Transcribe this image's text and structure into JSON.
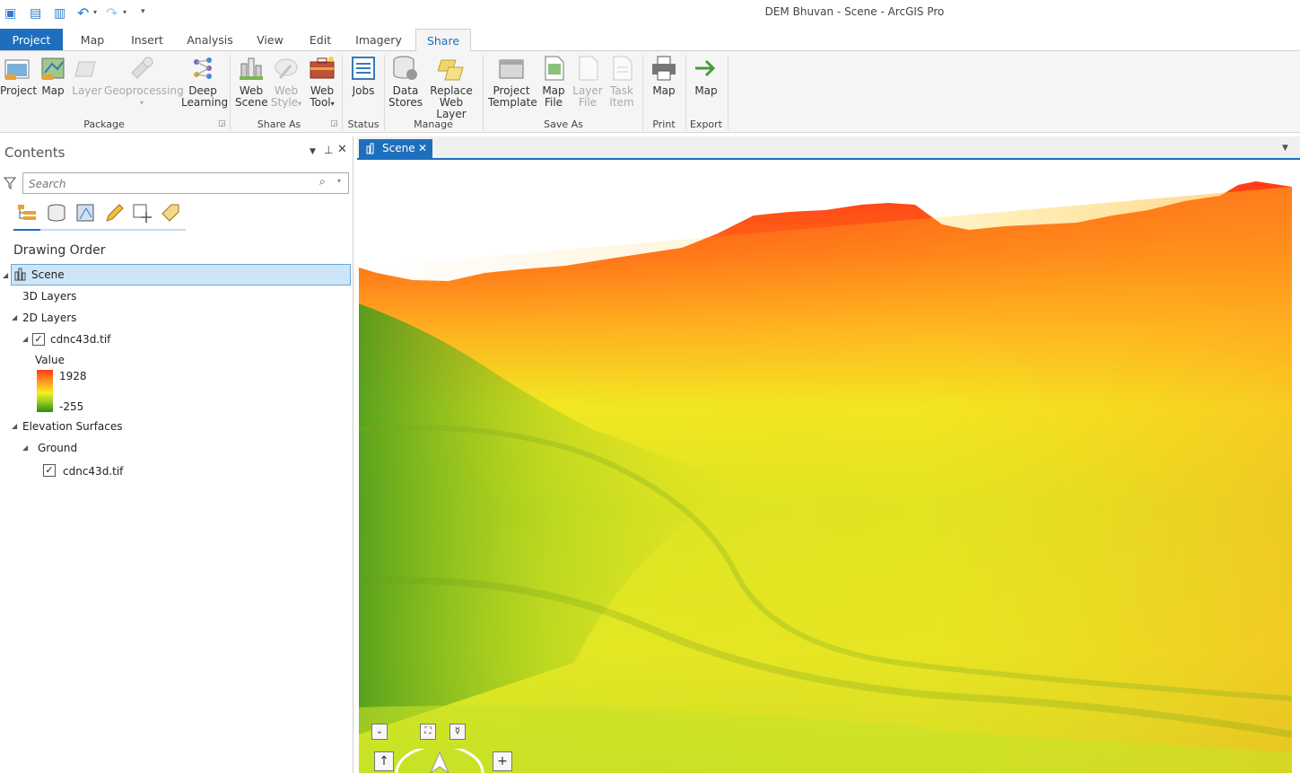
{
  "window": {
    "title": "DEM Bhuvan - Scene - ArcGIS Pro"
  },
  "tabs": [
    "Project",
    "Map",
    "Insert",
    "Analysis",
    "View",
    "Edit",
    "Imagery",
    "Share"
  ],
  "ribbon": {
    "package": {
      "group": "Package",
      "items": [
        [
          "Project"
        ],
        [
          "Map"
        ],
        [
          "Layer"
        ],
        [
          "Geoprocessing"
        ],
        [
          "Deep",
          "Learning"
        ]
      ]
    },
    "share_as": {
      "group": "Share As",
      "items": [
        [
          "Web",
          "Scene"
        ],
        [
          "Web",
          "Style"
        ],
        [
          "Web",
          "Tool"
        ]
      ]
    },
    "status": {
      "group": "Status",
      "items": [
        [
          "Jobs"
        ]
      ]
    },
    "manage": {
      "group": "Manage",
      "items": [
        [
          "Data",
          "Stores"
        ],
        [
          "Replace",
          "Web Layer"
        ]
      ]
    },
    "save_as": {
      "group": "Save As",
      "items": [
        [
          "Project",
          "Template"
        ],
        [
          "Map",
          "File"
        ],
        [
          "Layer",
          "File"
        ],
        [
          "Task",
          "Item"
        ]
      ]
    },
    "print": {
      "group": "Print",
      "items": [
        [
          "Map"
        ]
      ]
    },
    "export": {
      "group": "Export",
      "items": [
        [
          "Map"
        ]
      ]
    }
  },
  "contents": {
    "title": "Contents",
    "search_placeholder": "Search",
    "section": "Drawing Order",
    "scene": "Scene",
    "layers_3d": "3D Layers",
    "layers_2d": "2D Layers",
    "layer_name": "cdnc43d.tif",
    "legend_title": "Value",
    "legend_max": "1928",
    "legend_min": "-255",
    "elevation": "Elevation Surfaces",
    "ground": "Ground",
    "ground_layer": "cdnc43d.tif"
  },
  "view": {
    "tab_label": "Scene"
  },
  "colors": {
    "accent": "#1d6fbe",
    "ramp_high": "#ff3a16",
    "ramp_mid": "#f0f020",
    "ramp_low": "#2a8a1c"
  },
  "icons": [
    "filter-icon",
    "search-icon",
    "pin-icon",
    "close-icon",
    "compass-icon"
  ]
}
